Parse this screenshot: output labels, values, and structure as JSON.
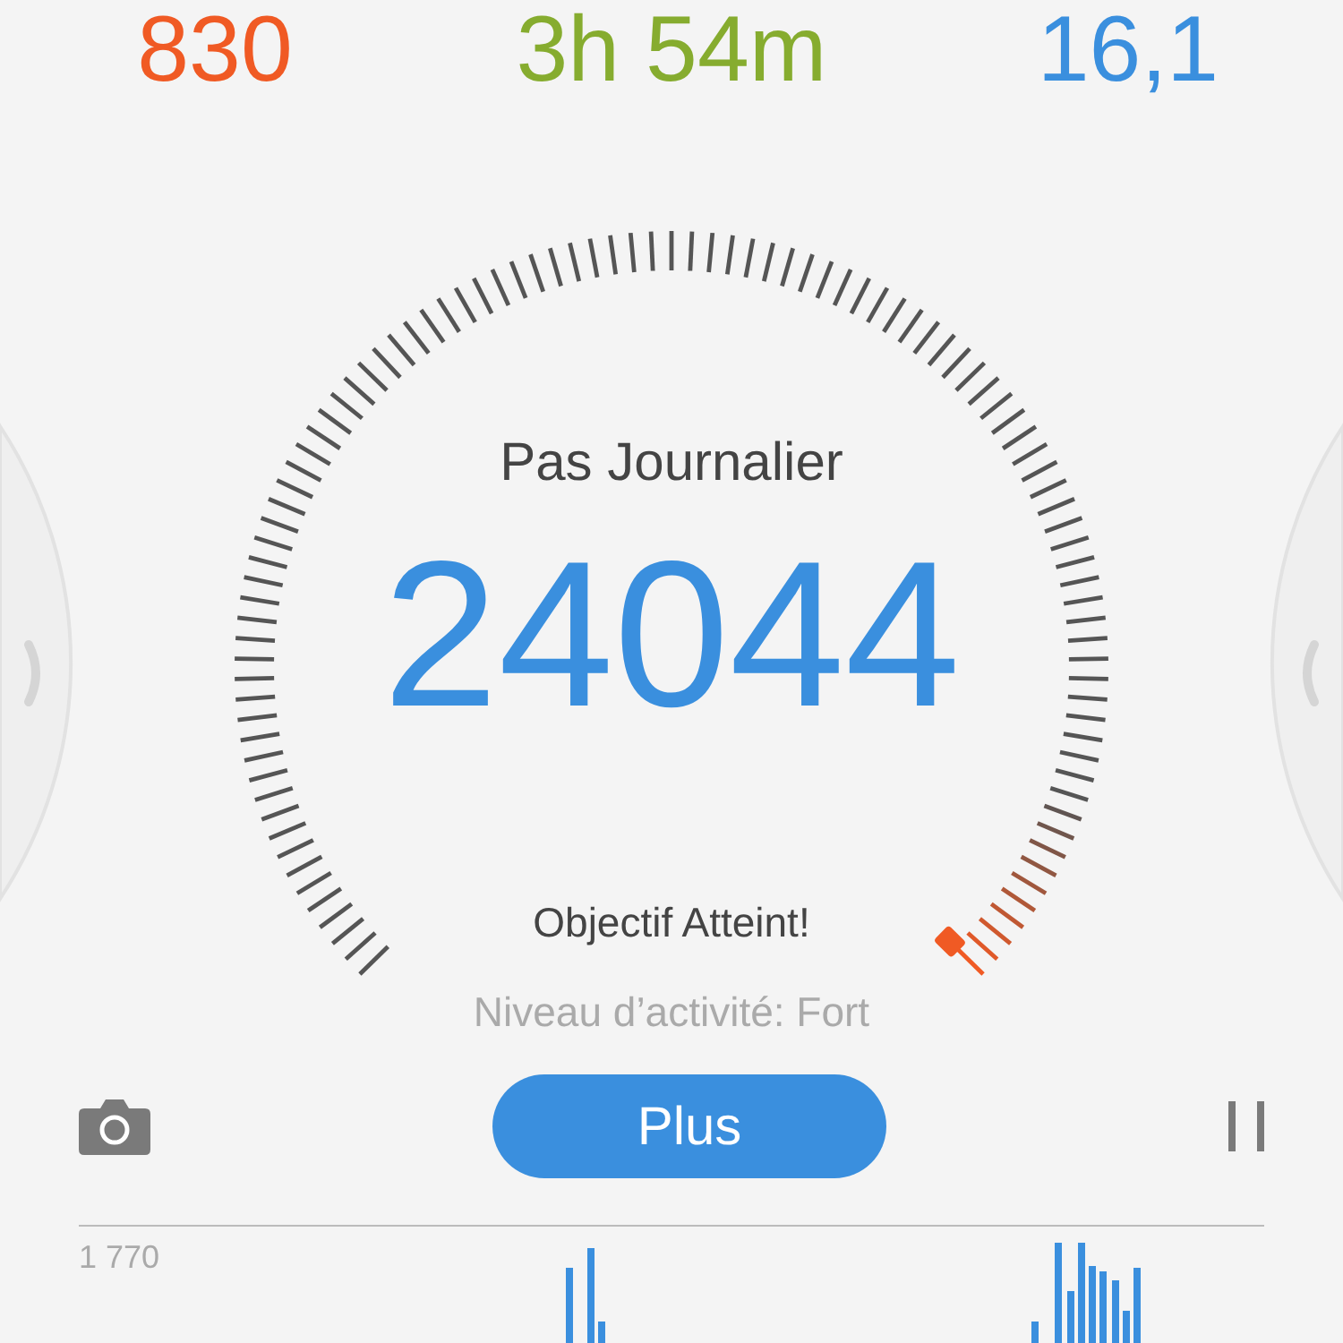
{
  "stats": [
    {
      "value": "830",
      "color": "#f05a24"
    },
    {
      "value": "3h 54m",
      "color": "#86ac2f"
    },
    {
      "value": "16,1",
      "color": "#3a8fde"
    }
  ],
  "gauge": {
    "title": "Pas Journalier",
    "steps": "24044",
    "status": "Objectif Atteint!",
    "activity": "Niveau d’activité: Fort"
  },
  "button": "Plus",
  "chart": {
    "max_label": "1 770"
  }
}
